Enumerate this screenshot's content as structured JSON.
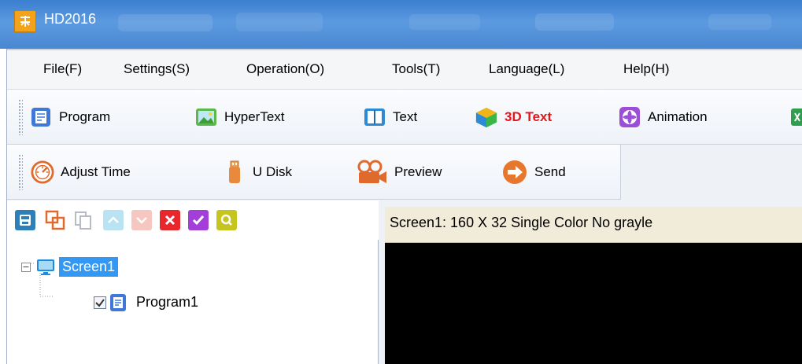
{
  "window": {
    "title": "HD2016",
    "logo_text": "HD"
  },
  "menu": [
    "File(F)",
    "Settings(S)",
    "Operation(O)",
    "Tools(T)",
    "Language(L)",
    "Help(H)"
  ],
  "toolbar1": [
    {
      "label": "Program",
      "icon": "program-icon"
    },
    {
      "label": "HyperText",
      "icon": "hypertext-icon"
    },
    {
      "label": "Text",
      "icon": "text-icon"
    },
    {
      "label": "3D Text",
      "icon": "3d-text-icon",
      "color": "#e8141b"
    },
    {
      "label": "Animation",
      "icon": "animation-icon"
    }
  ],
  "toolbar2": [
    {
      "label": "Adjust Time",
      "icon": "adjust-time-icon"
    },
    {
      "label": "U Disk",
      "icon": "u-disk-icon"
    },
    {
      "label": "Preview",
      "icon": "preview-icon"
    },
    {
      "label": "Send",
      "icon": "send-icon"
    }
  ],
  "tree": {
    "screen": "Screen1",
    "program": "Program1"
  },
  "preview": {
    "header": "Screen1: 160 X 32  Single Color No grayle"
  },
  "colors": {
    "selection": "#3398f3",
    "accent_red": "#e8141b"
  }
}
